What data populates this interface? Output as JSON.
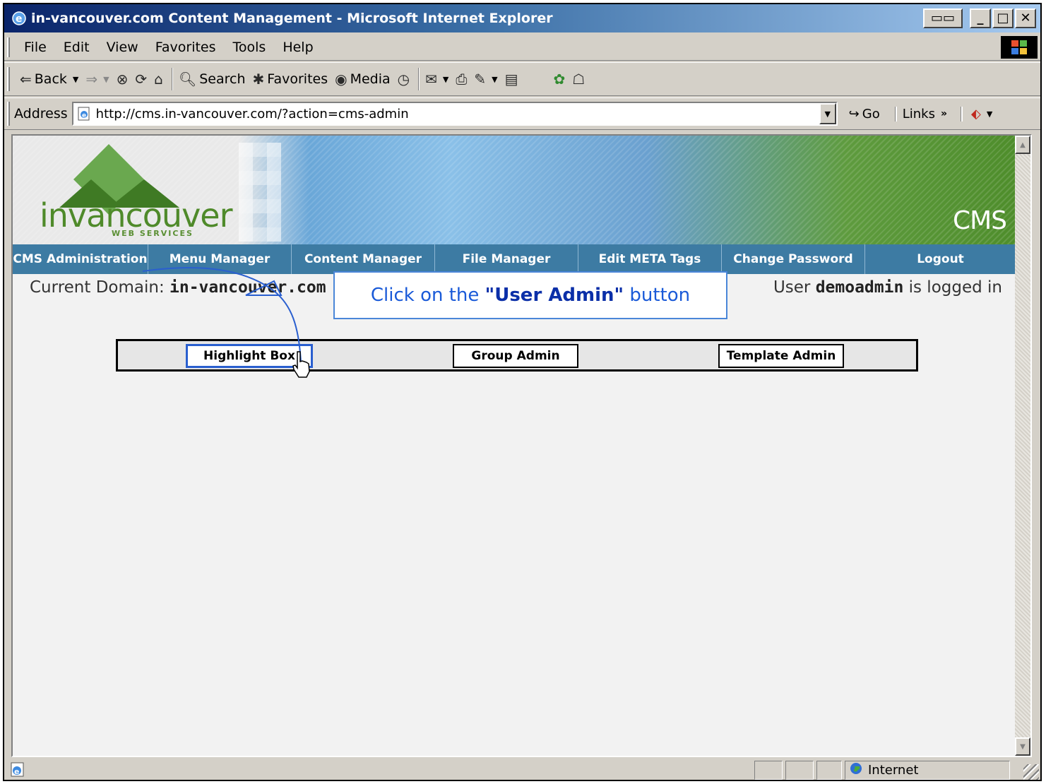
{
  "window": {
    "title": "in-vancouver.com Content Management - Microsoft Internet Explorer",
    "controls": [
      "min",
      "max",
      "close"
    ]
  },
  "menubar": {
    "items": [
      "File",
      "Edit",
      "View",
      "Favorites",
      "Tools",
      "Help"
    ]
  },
  "toolbar": {
    "back_label": "Back",
    "search_label": "Search",
    "favorites_label": "Favorites",
    "media_label": "Media"
  },
  "address": {
    "label": "Address",
    "url": "http://cms.in-vancouver.com/?action=cms-admin",
    "go_label": "Go",
    "links_label": "Links"
  },
  "banner": {
    "logo_text": "invancouver",
    "logo_sub": "WEB SERVICES",
    "cms_label": "CMS"
  },
  "nav": {
    "items": [
      {
        "label": "CMS Administration"
      },
      {
        "label": "Menu Manager"
      },
      {
        "label": "Content Manager"
      },
      {
        "label": "File Manager"
      },
      {
        "label": "Edit META Tags"
      },
      {
        "label": "Change Password"
      },
      {
        "label": "Logout"
      }
    ]
  },
  "content": {
    "domain_prefix": "Current Domain:",
    "domain": "in-vancouver.com",
    "user_prefix": "User",
    "username": "demoadmin",
    "user_suffix": "is logged in"
  },
  "callout": {
    "prefix": "Click on the",
    "highlight": "\"User Admin\"",
    "suffix": "button"
  },
  "admin_buttons": {
    "user": "Highlight Box",
    "group": "Group Admin",
    "template": "Template Admin"
  },
  "status": {
    "zone": "Internet"
  },
  "colors": {
    "nav_bg": "#3d7ba3",
    "callout_border": "#4a86d8",
    "callout_text": "#1a5ad8",
    "highlight_border": "#2a5fcf"
  }
}
